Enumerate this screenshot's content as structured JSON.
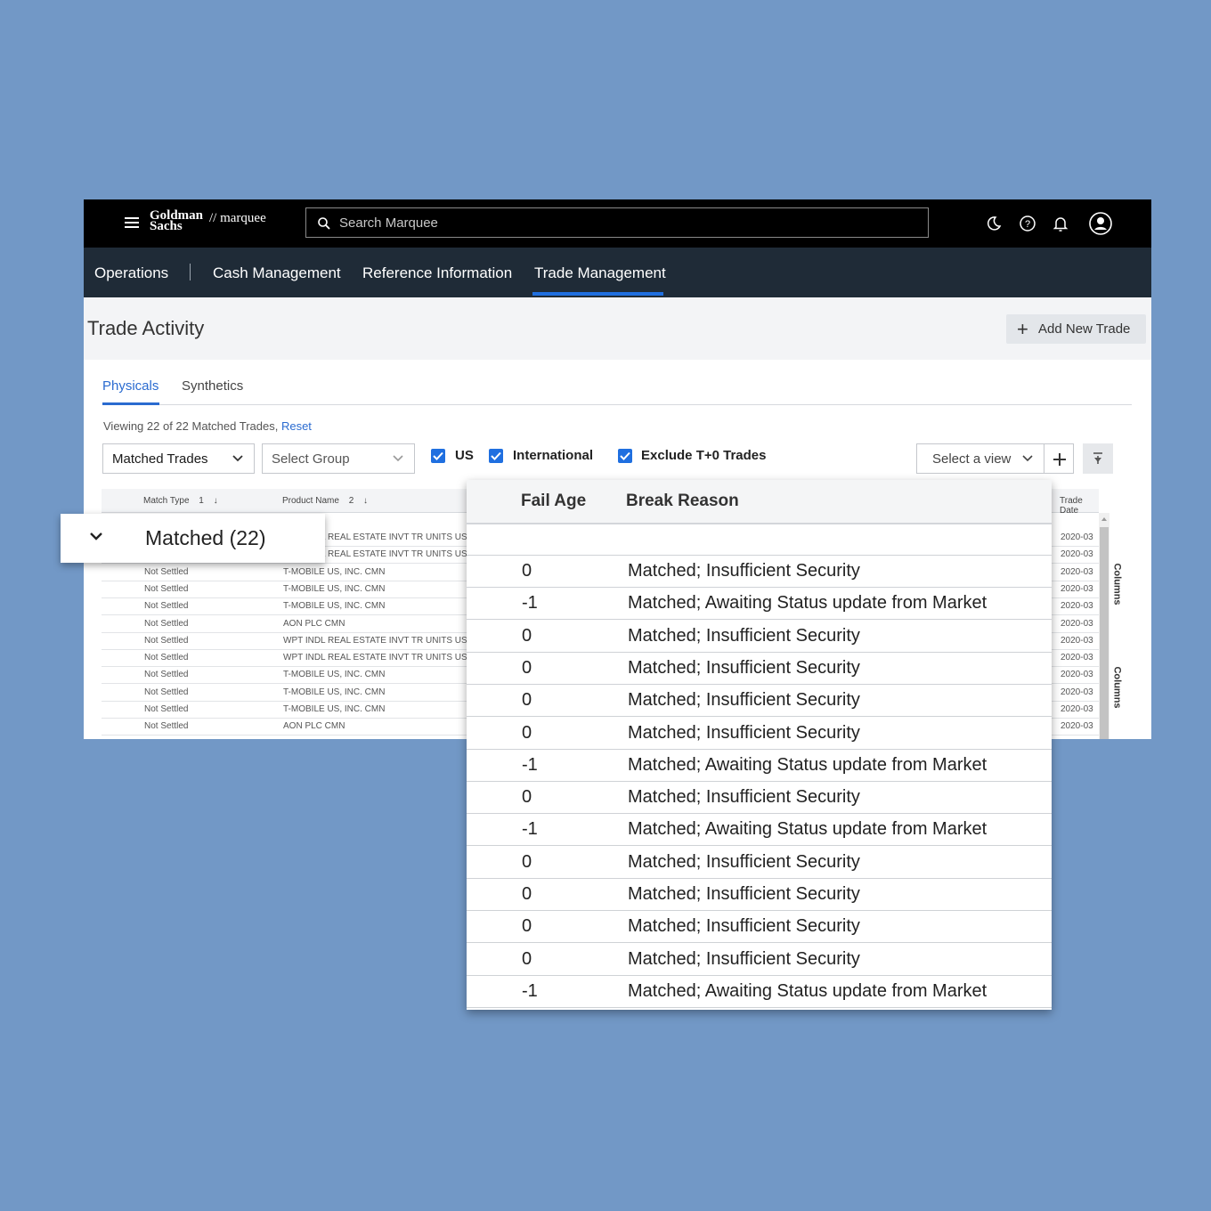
{
  "brand": {
    "line1": "Goldman",
    "line2": "Sachs",
    "product": "// marquee"
  },
  "search": {
    "placeholder": "Search Marquee"
  },
  "topbar_icons": [
    "moon-icon",
    "help-icon",
    "bell-icon",
    "user-icon"
  ],
  "nav": {
    "items": [
      "Operations",
      "Cash Management",
      "Reference Information",
      "Trade Management"
    ],
    "active": "Trade Management"
  },
  "page": {
    "title": "Trade Activity",
    "add_button": "Add New Trade"
  },
  "tabs": [
    "Physicals",
    "Synthetics"
  ],
  "viewing": {
    "text": "Viewing 22 of 22 Matched Trades,",
    "reset": "Reset"
  },
  "filters": {
    "trades_select": "Matched Trades",
    "group_select": "Select Group",
    "checkboxes": [
      {
        "label": "US",
        "checked": true
      },
      {
        "label": "International",
        "checked": true
      },
      {
        "label": "Exclude T+0 Trades",
        "checked": true
      }
    ],
    "view_select": "Select a view"
  },
  "grid": {
    "headers": {
      "match_type": "Match Type",
      "match_sort": "1",
      "product_name": "Product Name",
      "product_sort": "2",
      "trade_date": "Trade Date"
    },
    "rows": [
      {
        "status": "",
        "product": "WPT INDL REAL ESTATE INVT TR UNITS US",
        "date": "2020-03"
      },
      {
        "status": "",
        "product": "WPT INDL REAL ESTATE INVT TR UNITS US",
        "date": "2020-03"
      },
      {
        "status": "Not Settled",
        "product": "T-MOBILE US, INC. CMN",
        "date": "2020-03"
      },
      {
        "status": "Not Settled",
        "product": "T-MOBILE US, INC. CMN",
        "date": "2020-03"
      },
      {
        "status": "Not Settled",
        "product": "T-MOBILE US, INC. CMN",
        "date": "2020-03"
      },
      {
        "status": "Not Settled",
        "product": "AON PLC CMN",
        "date": "2020-03"
      },
      {
        "status": "Not Settled",
        "product": "WPT INDL REAL ESTATE INVT TR UNITS US",
        "date": "2020-03"
      },
      {
        "status": "Not Settled",
        "product": "WPT INDL REAL ESTATE INVT TR UNITS US",
        "date": "2020-03"
      },
      {
        "status": "Not Settled",
        "product": "T-MOBILE US, INC. CMN",
        "date": "2020-03"
      },
      {
        "status": "Not Settled",
        "product": "T-MOBILE US, INC. CMN",
        "date": "2020-03"
      },
      {
        "status": "Not Settled",
        "product": "T-MOBILE US, INC. CMN",
        "date": "2020-03"
      },
      {
        "status": "Not Settled",
        "product": "AON PLC CMN",
        "date": "2020-03"
      }
    ],
    "side_panel_label": "Columns"
  },
  "group_row": {
    "label": "Matched (22)"
  },
  "popup": {
    "headers": {
      "fail_age": "Fail Age",
      "break_reason": "Break Reason"
    },
    "rows": [
      {
        "fail_age": "0",
        "reason": "Matched; Insufficient Security"
      },
      {
        "fail_age": "-1",
        "reason": "Matched; Awaiting Status update from Market"
      },
      {
        "fail_age": "0",
        "reason": "Matched; Insufficient Security"
      },
      {
        "fail_age": "0",
        "reason": "Matched; Insufficient Security"
      },
      {
        "fail_age": "0",
        "reason": "Matched; Insufficient Security"
      },
      {
        "fail_age": "0",
        "reason": "Matched; Insufficient Security"
      },
      {
        "fail_age": "-1",
        "reason": "Matched; Awaiting Status update from Market"
      },
      {
        "fail_age": "0",
        "reason": "Matched; Insufficient Security"
      },
      {
        "fail_age": "-1",
        "reason": "Matched; Awaiting Status update from Market"
      },
      {
        "fail_age": "0",
        "reason": "Matched; Insufficient Security"
      },
      {
        "fail_age": "0",
        "reason": "Matched; Insufficient Security"
      },
      {
        "fail_age": "0",
        "reason": "Matched; Insufficient Security"
      },
      {
        "fail_age": "0",
        "reason": "Matched; Insufficient Security"
      },
      {
        "fail_age": "-1",
        "reason": "Matched; Awaiting Status update from Market"
      }
    ]
  },
  "colors": {
    "background": "#7298c6",
    "accent": "#1f6fe0",
    "navbar": "#1f2b37",
    "topbar": "#000000"
  }
}
